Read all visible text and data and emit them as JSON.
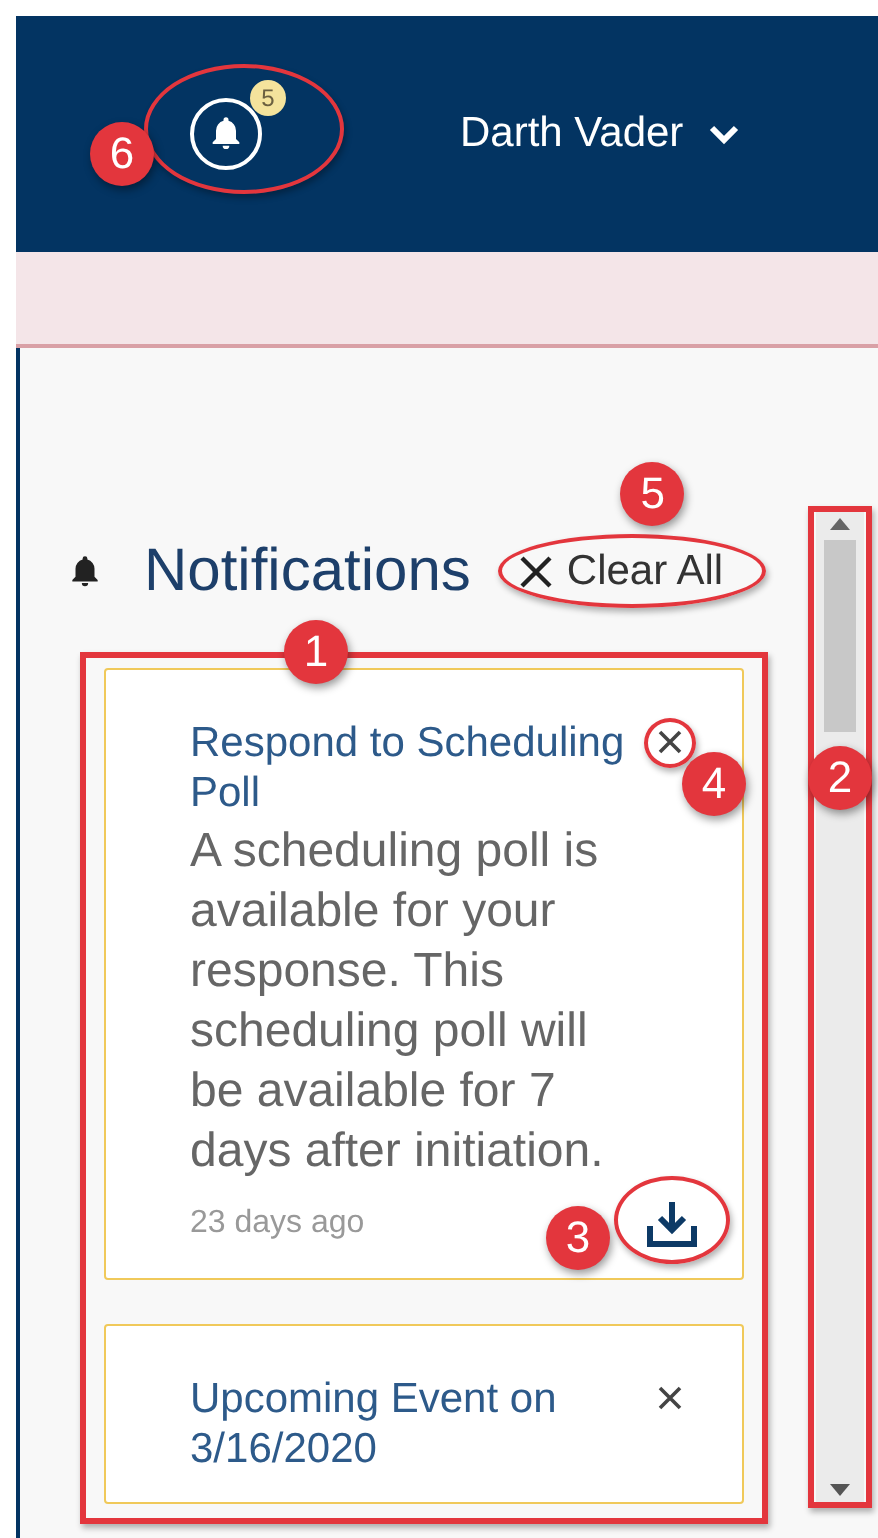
{
  "header": {
    "notification_count": "5",
    "user_name": "Darth Vader",
    "callout": "6"
  },
  "notifications": {
    "title": "Notifications",
    "clear_all": "Clear All",
    "clear_all_callout": "5",
    "list_callout": "1",
    "items": [
      {
        "title": "Respond to Scheduling Poll",
        "body": "A scheduling poll is available for your response. This scheduling poll will be available for 7 days after initiation.",
        "time": "23 days ago",
        "has_download": true,
        "close_callout": "4",
        "download_callout": "3"
      },
      {
        "title": "Upcoming Event on 3/16/2020",
        "has_download": false
      }
    ]
  },
  "scrollbar": {
    "callout": "2"
  }
}
